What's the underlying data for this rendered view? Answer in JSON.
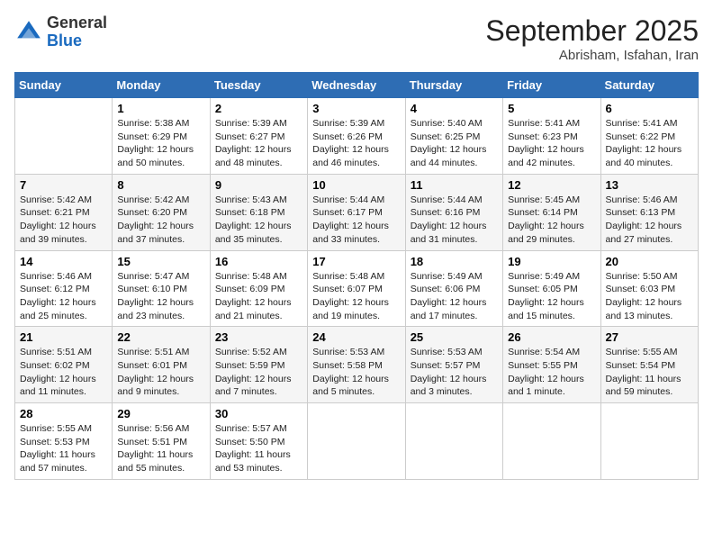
{
  "header": {
    "logo_line1": "General",
    "logo_line2": "Blue",
    "month": "September 2025",
    "location": "Abrisham, Isfahan, Iran"
  },
  "columns": [
    "Sunday",
    "Monday",
    "Tuesday",
    "Wednesday",
    "Thursday",
    "Friday",
    "Saturday"
  ],
  "weeks": [
    [
      {
        "day": "",
        "info": ""
      },
      {
        "day": "1",
        "info": "Sunrise: 5:38 AM\nSunset: 6:29 PM\nDaylight: 12 hours\nand 50 minutes."
      },
      {
        "day": "2",
        "info": "Sunrise: 5:39 AM\nSunset: 6:27 PM\nDaylight: 12 hours\nand 48 minutes."
      },
      {
        "day": "3",
        "info": "Sunrise: 5:39 AM\nSunset: 6:26 PM\nDaylight: 12 hours\nand 46 minutes."
      },
      {
        "day": "4",
        "info": "Sunrise: 5:40 AM\nSunset: 6:25 PM\nDaylight: 12 hours\nand 44 minutes."
      },
      {
        "day": "5",
        "info": "Sunrise: 5:41 AM\nSunset: 6:23 PM\nDaylight: 12 hours\nand 42 minutes."
      },
      {
        "day": "6",
        "info": "Sunrise: 5:41 AM\nSunset: 6:22 PM\nDaylight: 12 hours\nand 40 minutes."
      }
    ],
    [
      {
        "day": "7",
        "info": "Sunrise: 5:42 AM\nSunset: 6:21 PM\nDaylight: 12 hours\nand 39 minutes."
      },
      {
        "day": "8",
        "info": "Sunrise: 5:42 AM\nSunset: 6:20 PM\nDaylight: 12 hours\nand 37 minutes."
      },
      {
        "day": "9",
        "info": "Sunrise: 5:43 AM\nSunset: 6:18 PM\nDaylight: 12 hours\nand 35 minutes."
      },
      {
        "day": "10",
        "info": "Sunrise: 5:44 AM\nSunset: 6:17 PM\nDaylight: 12 hours\nand 33 minutes."
      },
      {
        "day": "11",
        "info": "Sunrise: 5:44 AM\nSunset: 6:16 PM\nDaylight: 12 hours\nand 31 minutes."
      },
      {
        "day": "12",
        "info": "Sunrise: 5:45 AM\nSunset: 6:14 PM\nDaylight: 12 hours\nand 29 minutes."
      },
      {
        "day": "13",
        "info": "Sunrise: 5:46 AM\nSunset: 6:13 PM\nDaylight: 12 hours\nand 27 minutes."
      }
    ],
    [
      {
        "day": "14",
        "info": "Sunrise: 5:46 AM\nSunset: 6:12 PM\nDaylight: 12 hours\nand 25 minutes."
      },
      {
        "day": "15",
        "info": "Sunrise: 5:47 AM\nSunset: 6:10 PM\nDaylight: 12 hours\nand 23 minutes."
      },
      {
        "day": "16",
        "info": "Sunrise: 5:48 AM\nSunset: 6:09 PM\nDaylight: 12 hours\nand 21 minutes."
      },
      {
        "day": "17",
        "info": "Sunrise: 5:48 AM\nSunset: 6:07 PM\nDaylight: 12 hours\nand 19 minutes."
      },
      {
        "day": "18",
        "info": "Sunrise: 5:49 AM\nSunset: 6:06 PM\nDaylight: 12 hours\nand 17 minutes."
      },
      {
        "day": "19",
        "info": "Sunrise: 5:49 AM\nSunset: 6:05 PM\nDaylight: 12 hours\nand 15 minutes."
      },
      {
        "day": "20",
        "info": "Sunrise: 5:50 AM\nSunset: 6:03 PM\nDaylight: 12 hours\nand 13 minutes."
      }
    ],
    [
      {
        "day": "21",
        "info": "Sunrise: 5:51 AM\nSunset: 6:02 PM\nDaylight: 12 hours\nand 11 minutes."
      },
      {
        "day": "22",
        "info": "Sunrise: 5:51 AM\nSunset: 6:01 PM\nDaylight: 12 hours\nand 9 minutes."
      },
      {
        "day": "23",
        "info": "Sunrise: 5:52 AM\nSunset: 5:59 PM\nDaylight: 12 hours\nand 7 minutes."
      },
      {
        "day": "24",
        "info": "Sunrise: 5:53 AM\nSunset: 5:58 PM\nDaylight: 12 hours\nand 5 minutes."
      },
      {
        "day": "25",
        "info": "Sunrise: 5:53 AM\nSunset: 5:57 PM\nDaylight: 12 hours\nand 3 minutes."
      },
      {
        "day": "26",
        "info": "Sunrise: 5:54 AM\nSunset: 5:55 PM\nDaylight: 12 hours\nand 1 minute."
      },
      {
        "day": "27",
        "info": "Sunrise: 5:55 AM\nSunset: 5:54 PM\nDaylight: 11 hours\nand 59 minutes."
      }
    ],
    [
      {
        "day": "28",
        "info": "Sunrise: 5:55 AM\nSunset: 5:53 PM\nDaylight: 11 hours\nand 57 minutes."
      },
      {
        "day": "29",
        "info": "Sunrise: 5:56 AM\nSunset: 5:51 PM\nDaylight: 11 hours\nand 55 minutes."
      },
      {
        "day": "30",
        "info": "Sunrise: 5:57 AM\nSunset: 5:50 PM\nDaylight: 11 hours\nand 53 minutes."
      },
      {
        "day": "",
        "info": ""
      },
      {
        "day": "",
        "info": ""
      },
      {
        "day": "",
        "info": ""
      },
      {
        "day": "",
        "info": ""
      }
    ]
  ]
}
